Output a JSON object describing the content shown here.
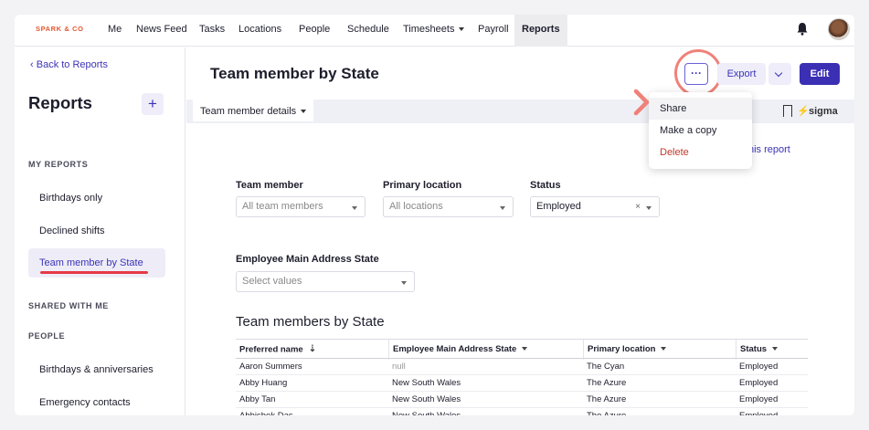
{
  "nav": {
    "logo": "SPARK & CO",
    "items": [
      "Me",
      "News Feed",
      "Tasks",
      "Locations",
      "People",
      "Schedule",
      "Timesheets",
      "Payroll",
      "Reports"
    ]
  },
  "sidebar": {
    "back_link": "Back to Reports",
    "title": "Reports",
    "add_label": "+",
    "my_reports_heading": "MY REPORTS",
    "my_reports": [
      "Birthdays only",
      "Declined shifts",
      "Team member by State"
    ],
    "shared_heading": "SHARED WITH ME",
    "people_heading": "PEOPLE",
    "people_items": [
      "Birthdays & anniversaries",
      "Emergency contacts"
    ]
  },
  "header": {
    "title": "Team member by State",
    "more_label": "···",
    "export_label": "Export",
    "edit_label": "Edit"
  },
  "tabs": {
    "active": "Team member details",
    "brand": "sigma"
  },
  "menu": {
    "items": [
      "Share",
      "Make a copy",
      "Delete"
    ]
  },
  "partial_link": "his report",
  "filters": {
    "team_member": {
      "label": "Team member",
      "placeholder": "All team members"
    },
    "primary_location": {
      "label": "Primary location",
      "placeholder": "All locations"
    },
    "status": {
      "label": "Status",
      "value": "Employed"
    },
    "address_state": {
      "label": "Employee Main Address State",
      "placeholder": "Select values"
    }
  },
  "table": {
    "title": "Team members by State",
    "columns": [
      "Preferred name",
      "Employee Main Address State",
      "Primary location",
      "Status"
    ],
    "rows": [
      [
        "Aaron Summers",
        "null",
        "The Cyan",
        "Employed"
      ],
      [
        "Abby Huang",
        "New South Wales",
        "The Azure",
        "Employed"
      ],
      [
        "Abby Tan",
        "New South Wales",
        "The Azure",
        "Employed"
      ],
      [
        "Abhishek Das",
        "New South Wales",
        "The Azure",
        "Employed"
      ]
    ]
  },
  "colors": {
    "accent": "#3b2fb4",
    "highlight": "#f08179",
    "danger": "#c0392b"
  }
}
